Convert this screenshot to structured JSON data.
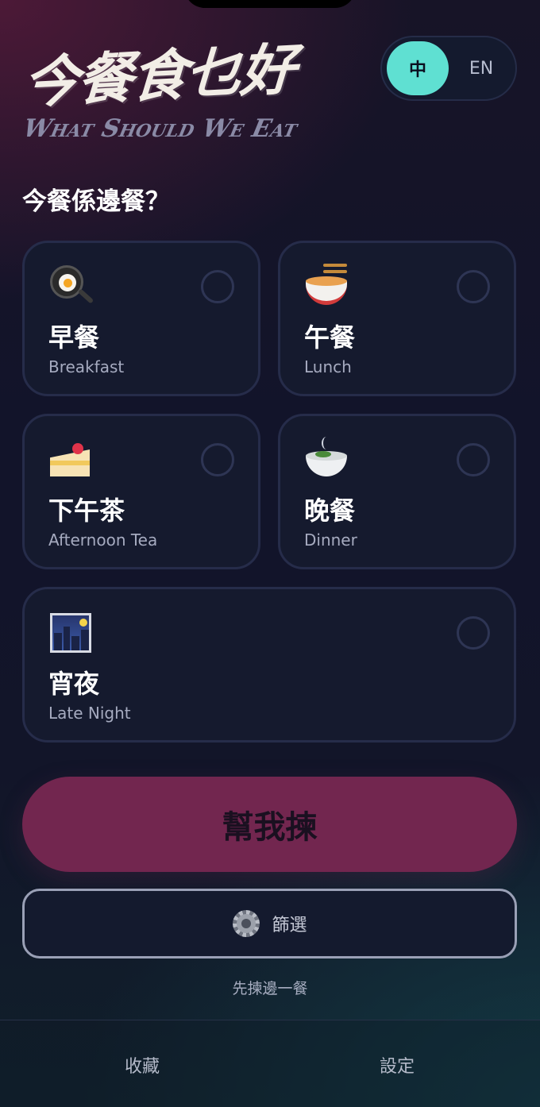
{
  "logo": {
    "title_cn": "今餐食乜好",
    "title_en": "What Should We Eat"
  },
  "language": {
    "zh_label": "中",
    "en_label": "EN",
    "selected": "中",
    "accent": "#5fe0d2"
  },
  "prompt": "今餐係邊餐？",
  "meals": [
    {
      "title": "早餐",
      "subtitle": "Breakfast",
      "icon": "frying-pan-egg-icon",
      "selected": false
    },
    {
      "title": "午餐",
      "subtitle": "Lunch",
      "icon": "noodle-bowl-icon",
      "selected": false
    },
    {
      "title": "下午茶",
      "subtitle": "Afternoon Tea",
      "icon": "cake-slice-icon",
      "selected": false
    },
    {
      "title": "晚餐",
      "subtitle": "Dinner",
      "icon": "soup-bowl-icon",
      "selected": false
    },
    {
      "title": "宵夜",
      "subtitle": "Late Night",
      "icon": "night-city-icon",
      "selected": false
    }
  ],
  "actions": {
    "pick_label": "幫我揀",
    "pick_color": "#72264f",
    "filter_label": "篩選",
    "filter_icon": "gear-icon",
    "hint": "先揀邊一餐"
  },
  "tabbar": {
    "favorites_label": "收藏",
    "settings_label": "設定"
  }
}
